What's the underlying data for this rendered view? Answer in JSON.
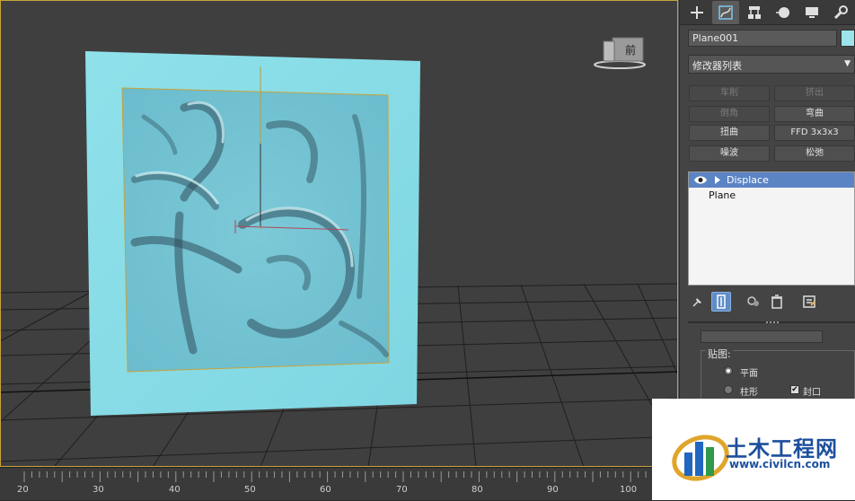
{
  "viewport": {
    "nav_cube_label": "前"
  },
  "timeline": {
    "ticks": [
      "20",
      "30",
      "40",
      "50",
      "60",
      "70",
      "80",
      "90",
      "100"
    ]
  },
  "panel": {
    "tabs": [
      "create",
      "modify",
      "hierarchy",
      "motion",
      "display",
      "utilities"
    ],
    "object_name": "Plane001",
    "object_color": "#9de3ec",
    "modifier_list": "修改器列表",
    "modifier_buttons": [
      {
        "label": "车削",
        "enabled": false
      },
      {
        "label": "挤出",
        "enabled": false
      },
      {
        "label": "倒角",
        "enabled": false
      },
      {
        "label": "弯曲",
        "enabled": true
      },
      {
        "label": "扭曲",
        "enabled": true
      },
      {
        "label": "FFD 3x3x3",
        "enabled": true
      },
      {
        "label": "噪波",
        "enabled": true
      },
      {
        "label": "松弛",
        "enabled": true
      }
    ],
    "stack": [
      {
        "label": "Displace",
        "selected": true
      },
      {
        "label": "Plane",
        "selected": false
      }
    ],
    "map_group_title": "贴图:",
    "map_options": {
      "planar": "平面",
      "cylindrical": "柱形",
      "cap": "封口"
    }
  },
  "watermark": {
    "title": "土木工程网",
    "url": "www.civilcn.com"
  },
  "colors": {
    "plane": "#8fdfe9",
    "selection": "#5b84c4",
    "viewport_bg": "#3f3f3f",
    "frame": "#c9a33a"
  }
}
